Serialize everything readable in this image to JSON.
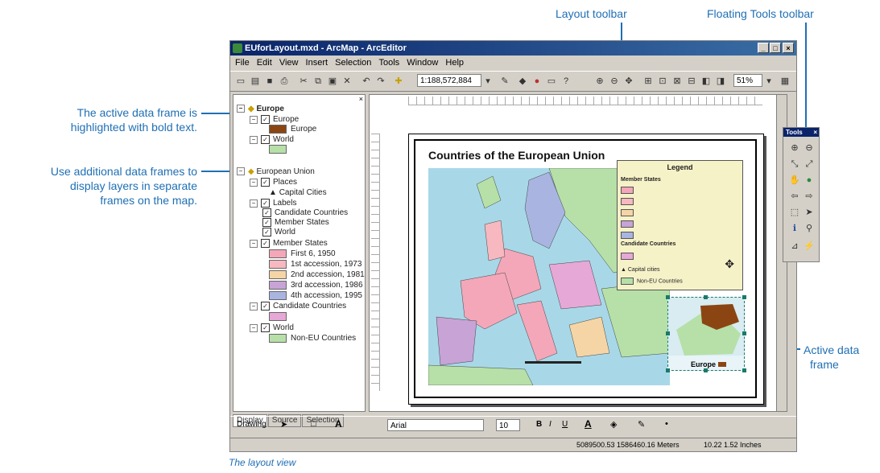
{
  "callouts": {
    "layout_toolbar": "Layout toolbar",
    "floating_tools_toolbar": "Floating Tools toolbar",
    "active_frame_bold_line1": "The active data frame is",
    "active_frame_bold_line2": "highlighted with bold text.",
    "additional_frames_line1": "Use additional data frames to",
    "additional_frames_line2": "display layers in separate",
    "additional_frames_line3": "frames on the map.",
    "active_data_frame_line1": "Active data",
    "active_data_frame_line2": "frame"
  },
  "caption": "The layout view",
  "window": {
    "title": "EUforLayout.mxd - ArcMap - ArcEditor",
    "min_glyph": "_",
    "max_glyph": "□",
    "close_glyph": "×"
  },
  "menu": [
    "File",
    "Edit",
    "View",
    "Insert",
    "Selection",
    "Tools",
    "Window",
    "Help"
  ],
  "toolbar": {
    "scale": "1:188,572,884",
    "zoom": "51%"
  },
  "toc": {
    "frame1": "Europe",
    "layer_europe": "Europe",
    "europe_sym": "Europe",
    "layer_world": "World",
    "frame2": "European Union",
    "places": "Places",
    "capital_cities": "Capital Cities",
    "labels": "Labels",
    "cand_countries": "Candidate Countries",
    "member_states_lbl": "Member States",
    "world_lbl": "World",
    "member_states": "Member States",
    "first6": "First 6, 1950",
    "acc1": "1st accession, 1973",
    "acc2": "2nd accession, 1981",
    "acc3": "3rd accession, 1986",
    "acc4": "4th accession, 1995",
    "candidate_countries": "Candidate Countries",
    "world": "World",
    "non_eu": "Non-EU Countries"
  },
  "tabs": [
    "Display",
    "Source",
    "Selection"
  ],
  "map": {
    "title": "Countries of the European Union",
    "legend_title": "Legend",
    "legend_member_states": "Member States",
    "legend_candidate": "Candidate Countries",
    "legend_capital": "Capital cities",
    "legend_nonmember": "Non-EU Countries",
    "inset_label": "Europe"
  },
  "tools_palette": {
    "title": "Tools"
  },
  "drawbar": {
    "drawing": "Drawing",
    "font": "Arial",
    "size": "10",
    "bold": "B",
    "italic": "I",
    "underline": "U"
  },
  "status": {
    "coords": "5089500.53  1586460.16 Meters",
    "page_pos": "10.22  1.52 Inches"
  },
  "colors": {
    "callout": "#1f6fb4",
    "first6": "#f4a7b9",
    "acc1": "#f7b8c0",
    "acc2": "#f5d5a6",
    "acc3": "#c7a3d6",
    "acc4": "#a9b5e0",
    "candidate": "#e6a8d6",
    "nonEU": "#b6e0a8",
    "europe": "#8b4513"
  }
}
